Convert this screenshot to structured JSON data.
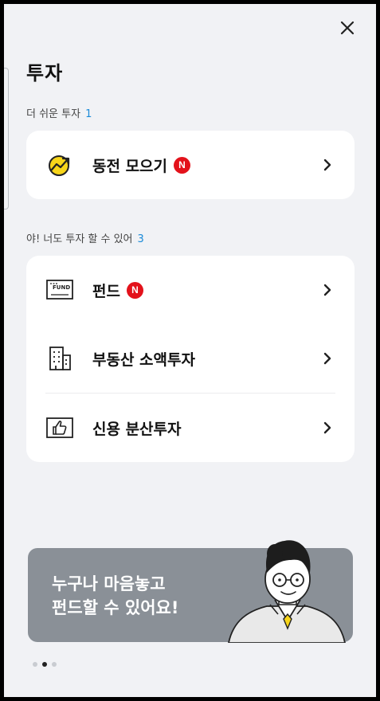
{
  "header": {
    "title": "투자",
    "close_icon": "close-icon"
  },
  "sections": [
    {
      "label": "더 쉬운 투자",
      "count": "1",
      "items": [
        {
          "label": "동전 모으기",
          "badge": "N",
          "icon": "coin-growth-icon"
        }
      ]
    },
    {
      "label": "야! 너도 투자 할 수 있어",
      "count": "3",
      "items": [
        {
          "label": "펀드",
          "badge": "N",
          "icon": "fund-card-icon"
        },
        {
          "label": "부동산 소액투자",
          "badge": "",
          "icon": "building-icon"
        },
        {
          "label": "신용 분산투자",
          "badge": "",
          "icon": "thumbs-up-icon"
        }
      ]
    }
  ],
  "fund_icon_text": "FUND",
  "banner": {
    "line1": "누구나 마음놓고",
    "line2": "펀드할 수 있어요!",
    "background": "#8a9097"
  },
  "pager": {
    "total": 3,
    "active": 2
  },
  "colors": {
    "badge": "#e3121b",
    "count": "#1a8ad8",
    "coin": "#f7d51a"
  }
}
